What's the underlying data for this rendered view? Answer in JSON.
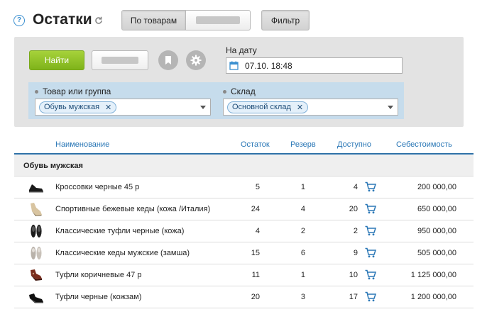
{
  "header": {
    "help_symbol": "?",
    "title": "Остатки",
    "tab_by_goods": "По товарам",
    "filter_label": "Фильтр"
  },
  "panel": {
    "find_label": "Найти",
    "date_label": "На дату",
    "date_value": "07.10. 18:48",
    "goods_label": "Товар или группа",
    "goods_chip": "Обувь мужская",
    "warehouse_label": "Склад",
    "warehouse_chip": "Основной склад",
    "chip_remove": "✕"
  },
  "table": {
    "columns": {
      "name": "Наименование",
      "stock": "Остаток",
      "reserve": "Резерв",
      "available": "Доступно",
      "cost": "Себестоимость"
    },
    "group": "Обувь мужская",
    "rows": [
      {
        "name": "Кроссовки черные 45 р",
        "stock": "5",
        "reserve": "1",
        "available": "4",
        "cost": "200 000,00",
        "icon": "sneaker-black"
      },
      {
        "name": "Спортивные бежевые кеды (кожа /Италия)",
        "stock": "24",
        "reserve": "4",
        "available": "20",
        "cost": "650 000,00",
        "icon": "sneaker-beige"
      },
      {
        "name": "Классические туфли черные (кожа)",
        "stock": "4",
        "reserve": "2",
        "available": "2",
        "cost": "950 000,00",
        "icon": "shoes-black-top"
      },
      {
        "name": "Классические кеды мужские (замша)",
        "stock": "15",
        "reserve": "6",
        "available": "9",
        "cost": "505 000,00",
        "icon": "insoles-grey"
      },
      {
        "name": "Туфли коричневые 47 р",
        "stock": "11",
        "reserve": "1",
        "available": "10",
        "cost": "1 125 000,00",
        "icon": "shoes-brown"
      },
      {
        "name": "Туфли черные (кожзам)",
        "stock": "20",
        "reserve": "3",
        "available": "17",
        "cost": "1 200 000,00",
        "icon": "shoes-black"
      }
    ]
  },
  "colors": {
    "accent_blue": "#2a77b6",
    "find_green": "#8cc12a",
    "panel_grey": "#e3e3e3",
    "filter_row_blue": "#c6dcec"
  }
}
